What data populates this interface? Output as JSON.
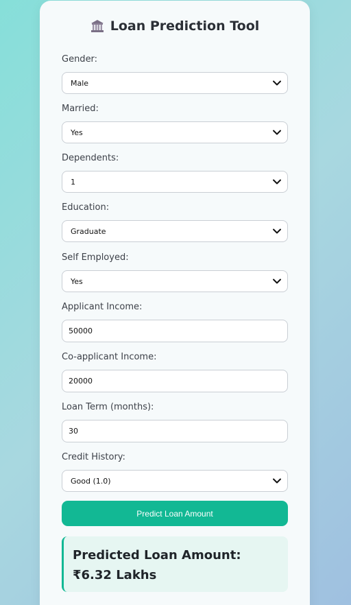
{
  "app": {
    "title": "Loan Prediction Tool",
    "title_icon": "bank-icon"
  },
  "colors": {
    "accent": "#12b894",
    "result_bg": "#e6f6f2",
    "card_bg": "#f6fafb"
  },
  "form": {
    "gender": {
      "label": "Gender:",
      "value": "Male"
    },
    "married": {
      "label": "Married:",
      "value": "Yes"
    },
    "dependents": {
      "label": "Dependents:",
      "value": "1"
    },
    "education": {
      "label": "Education:",
      "value": "Graduate"
    },
    "self_employed": {
      "label": "Self Employed:",
      "value": "Yes"
    },
    "applicant_income": {
      "label": "Applicant Income:",
      "value": "50000"
    },
    "coapplicant_income": {
      "label": "Co-applicant Income:",
      "value": "20000"
    },
    "loan_term": {
      "label": "Loan Term (months):",
      "value": "30"
    },
    "credit_history": {
      "label": "Credit History:",
      "value": "Good (1.0)"
    }
  },
  "actions": {
    "predict_label": "Predict Loan Amount"
  },
  "result": {
    "text": "Predicted Loan Amount: ₹6.32 Lakhs"
  }
}
